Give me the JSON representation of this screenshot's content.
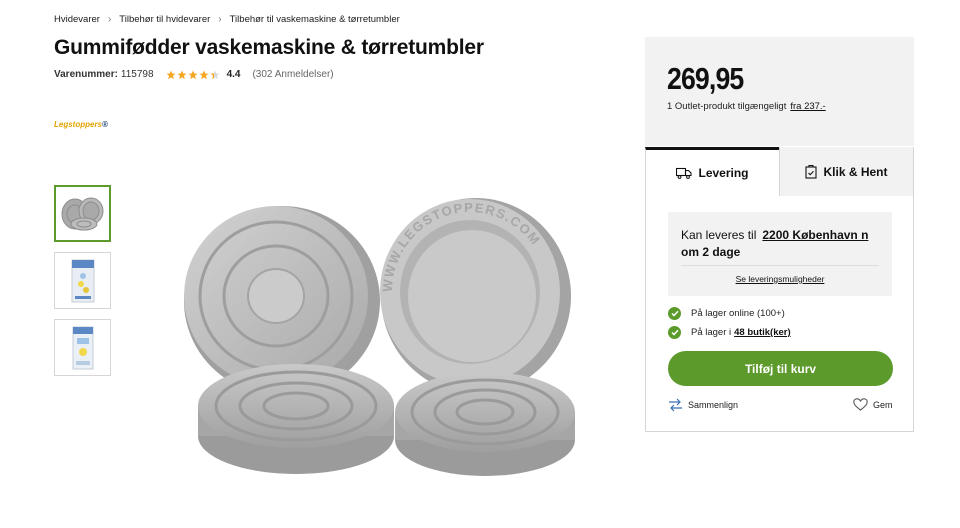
{
  "breadcrumb": [
    "Hvidevarer",
    "Tilbehør til hvidevarer",
    "Tilbehør til vaskemaskine & tørretumbler"
  ],
  "product": {
    "title": "Gummifødder vaskemaskine & tørretumbler",
    "sku_label": "Varenummer:",
    "sku": "115798",
    "rating": "4.4",
    "rating_value": 4.4,
    "reviews": "(302 Anmeldelser)",
    "brand_logo": {
      "main": "Legstoppers",
      "suffix": "®"
    },
    "image_embossed_text": "WWW.LEGSTOPPERS.COM"
  },
  "gallery": {
    "thumbnails": [
      "rubber-feet-thumbnail",
      "package-front-thumbnail",
      "package-side-thumbnail"
    ],
    "selected_index": 0
  },
  "pricing": {
    "price": "269,95",
    "outlet_text": "1 Outlet-produkt tilgængeligt",
    "outlet_link": "fra 237.-"
  },
  "tabs": [
    {
      "label": "Levering",
      "icon": "truck-icon",
      "active": true
    },
    {
      "label": "Klik & Hent",
      "icon": "store-pickup-icon",
      "active": false
    }
  ],
  "delivery": {
    "prefix": "Kan leveres til",
    "address": "2200 København n",
    "timeframe": "om 2 dage",
    "options_link": "Se leveringsmuligheder"
  },
  "stock": {
    "online": "På lager online (100+)",
    "stores_prefix": "På lager i",
    "stores_link": "48 butik(ker)"
  },
  "actions": {
    "add_to_cart": "Tilføj til kurv",
    "compare": "Sammenlign",
    "save": "Gem"
  },
  "colors": {
    "accent_green": "#5c9a2c",
    "star": "#f5a623",
    "panel_bg": "#f2f2f2"
  }
}
